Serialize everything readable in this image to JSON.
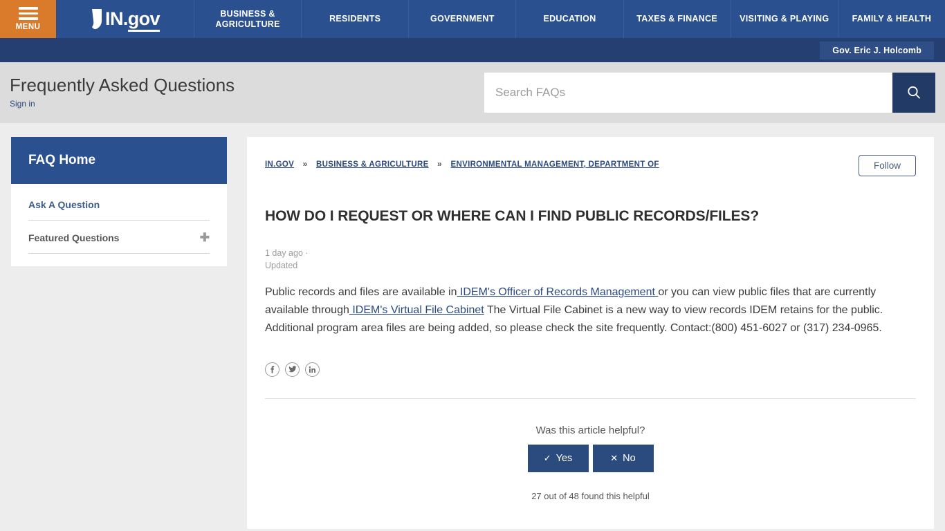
{
  "topnav": {
    "menu_label": "MENU",
    "logo_text_in": "IN.",
    "logo_text_gov": "gov",
    "items": [
      {
        "label": "BUSINESS & AGRICULTURE"
      },
      {
        "label": "RESIDENTS"
      },
      {
        "label": "GOVERNMENT"
      },
      {
        "label": "EDUCATION"
      },
      {
        "label": "TAXES & FINANCE"
      },
      {
        "label": "VISITING & PLAYING"
      },
      {
        "label": "FAMILY & HEALTH"
      }
    ],
    "colors": {
      "nav_blue": "#2b5090",
      "menu_orange": "#d97b2b",
      "subbar_blue": "#253f72"
    }
  },
  "subbar": {
    "governor_label": "Gov. Eric J. Holcomb"
  },
  "pagehead": {
    "title": "Frequently Asked Questions",
    "signin_label": "Sign in"
  },
  "search": {
    "placeholder": "Search FAQs",
    "value": "",
    "icon": "search-icon",
    "button_color": "#223a66"
  },
  "sidebar": {
    "header": "FAQ Home",
    "items": [
      {
        "label": "Ask A Question",
        "expander": ""
      },
      {
        "label": "Featured Questions",
        "expander": "✚"
      }
    ]
  },
  "article": {
    "breadcrumb": [
      {
        "label": "IN.GOV"
      },
      {
        "label": "BUSINESS & AGRICULTURE"
      },
      {
        "label": "ENVIRONMENTAL MANAGEMENT, DEPARTMENT OF"
      }
    ],
    "breadcrumb_separator": "»",
    "follow_label": "Follow",
    "title": "HOW DO I REQUEST OR WHERE CAN I FIND PUBLIC RECORDS/FILES?",
    "meta_time": "1 day ago ·",
    "meta_status": "Updated",
    "body": {
      "part1": "Public records and files are available in",
      "link1": " IDEM's Officer of Records Management ",
      "part2": "or you can view public files that are currently available through",
      "link2": " IDEM's Virtual File Cabinet",
      "part3": " The Virtual File Cabinet is a new way to view records IDEM retains for the public. Additional program area files are being added, so please check the site frequently. Contact:(800) 451-6027 or (317) 234-0965."
    },
    "social": [
      {
        "name": "facebook-icon",
        "glyph": "f"
      },
      {
        "name": "twitter-icon",
        "glyph": "🐦"
      },
      {
        "name": "linkedin-icon",
        "glyph": "in"
      }
    ]
  },
  "helpful": {
    "question": "Was this article helpful?",
    "yes_label": "Yes",
    "yes_glyph": "✓",
    "no_label": "No",
    "no_glyph": "✕",
    "count_text": "27 out of 48 found this helpful"
  }
}
